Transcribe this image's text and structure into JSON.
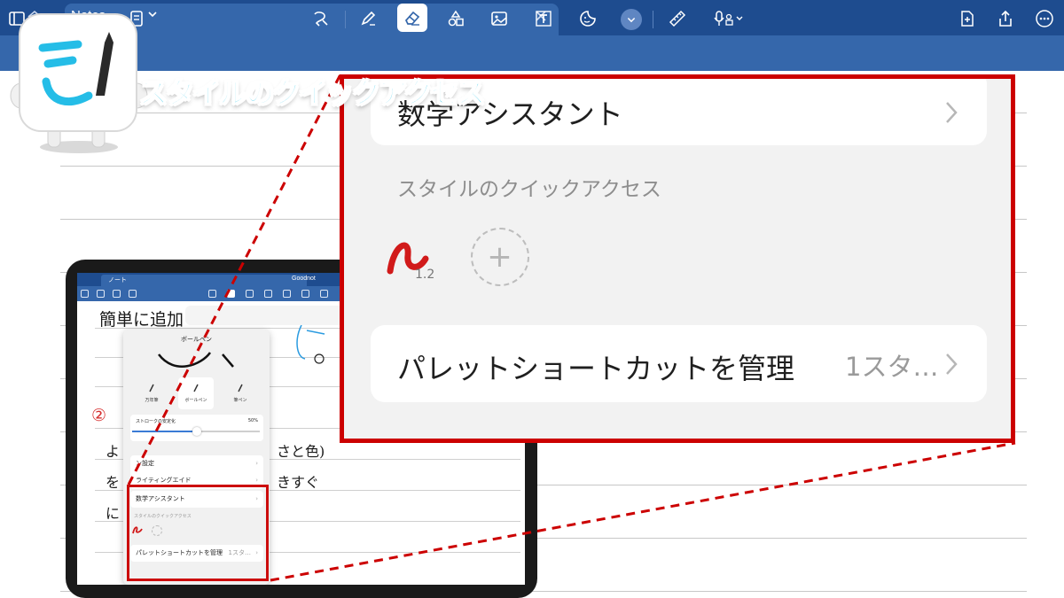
{
  "app": {
    "tab_title": "Notes",
    "tab_close_glyph": "×"
  },
  "toolbar": {
    "icons": [
      "sidebar-icon",
      "search-icon",
      "undo-icon",
      "page-icon",
      "lasso-icon",
      "pen-icon",
      "eraser-icon",
      "shapes-icon",
      "image-icon",
      "text-box-icon",
      "sticker-icon",
      "more-tools-chevron-icon",
      "ruler-icon",
      "microphone-icon",
      "add-page-icon",
      "share-icon",
      "more-icon"
    ],
    "active_tool": "eraser-icon"
  },
  "caption": "スタイルのクイックアクセス",
  "ipad": {
    "tab_title": "ノート",
    "tab_right": "Goodnot",
    "handwriting": {
      "line1": "簡単に追加",
      "circled": "②",
      "line2": "よ",
      "line2b": "さと色)",
      "line3": "を",
      "line3b": "きすぐ",
      "line4": "に"
    },
    "popover": {
      "title": "ボールペン",
      "pens": [
        "万年筆",
        "ボールペン",
        "筆ペン"
      ],
      "selected_pen": "ボールペン",
      "stroke_label": "ストロークの安定化",
      "stroke_value": "50%",
      "stroke_fraction": 0.5,
      "rows": [
        "ン設定",
        "ライティングエイド"
      ],
      "math": "数学アシスタント",
      "quick_access": "スタイルのクイックアクセス",
      "manage": "パレットショートカットを管理",
      "manage_value": "1スタ…"
    }
  },
  "zoom": {
    "math_assistant": "数学アシスタント",
    "quick_access_label": "スタイルのクイックアクセス",
    "stroke_size": "1.2",
    "manage_label": "パレットショートカットを管理",
    "manage_value": "1スタ…",
    "add_glyph": "+"
  },
  "colors": {
    "accent_blue": "#3567ab",
    "tabbar_blue": "#1e4c8f",
    "highlight_red": "#cc0000",
    "caption_cyan": "#2bc6ea",
    "stroke_red": "#d11a1a"
  }
}
